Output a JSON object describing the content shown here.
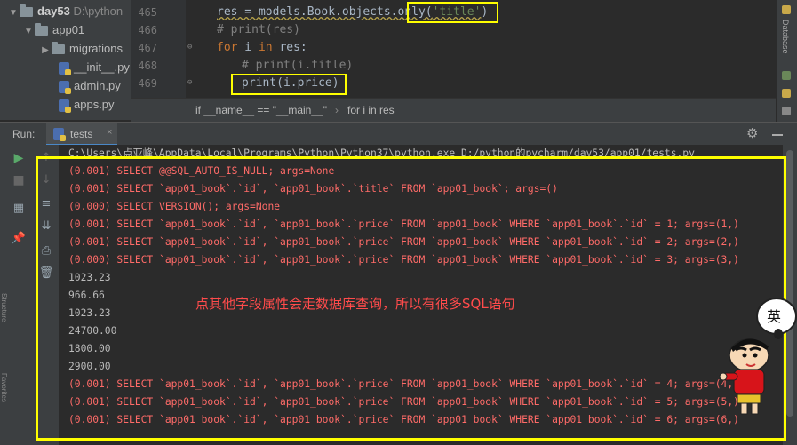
{
  "project": {
    "items": [
      {
        "label": "day53",
        "suffix": "D:\\python",
        "kind": "folder",
        "expanded": true,
        "icon": "folder-icon"
      },
      {
        "label": "app01",
        "kind": "folder",
        "expanded": true,
        "icon": "folder-icon"
      },
      {
        "label": "migrations",
        "kind": "folder",
        "expanded": false,
        "icon": "folder-icon"
      },
      {
        "label": "__init__.py",
        "kind": "file",
        "icon": "python-file-icon"
      },
      {
        "label": "admin.py",
        "kind": "file",
        "icon": "python-file-icon"
      },
      {
        "label": "apps.py",
        "kind": "file",
        "icon": "python-file-icon"
      }
    ]
  },
  "editor": {
    "line_numbers": [
      "465",
      "466",
      "467",
      "468",
      "469"
    ],
    "lines": [
      {
        "pre": "res = models.Book.objects.only(",
        "str": "'title'",
        "post": ")"
      },
      {
        "comment": "# print(res)"
      },
      {
        "kw": "for",
        "text1": " i ",
        "kw2": "in",
        "text2": " res:"
      },
      {
        "comment": "# print(i.title)"
      },
      {
        "text": "print(i.price)"
      }
    ]
  },
  "breadcrumb": {
    "items": [
      "if __name__ == \"__main__\"",
      "for i in res"
    ]
  },
  "run": {
    "label": "Run:",
    "tab": "tests",
    "close_glyph": "×"
  },
  "console": {
    "lines": [
      {
        "text": "C:\\Users\\点亚峰\\AppData\\Local\\Programs\\Python\\Python37\\python.exe D:/python的pycharm/day53/app01/tests.py",
        "style": "plain"
      },
      {
        "text": "(0.001) SELECT @@SQL_AUTO_IS_NULL; args=None",
        "style": "red"
      },
      {
        "text": "(0.001) SELECT `app01_book`.`id`, `app01_book`.`title` FROM `app01_book`; args=()",
        "style": "red"
      },
      {
        "text": "(0.000) SELECT VERSION(); args=None",
        "style": "red"
      },
      {
        "text": "(0.001) SELECT `app01_book`.`id`, `app01_book`.`price` FROM `app01_book` WHERE `app01_book`.`id` = 1; args=(1,)",
        "style": "red"
      },
      {
        "text": "(0.001) SELECT `app01_book`.`id`, `app01_book`.`price` FROM `app01_book` WHERE `app01_book`.`id` = 2; args=(2,)",
        "style": "red"
      },
      {
        "text": "(0.000) SELECT `app01_book`.`id`, `app01_book`.`price` FROM `app01_book` WHERE `app01_book`.`id` = 3; args=(3,)",
        "style": "red"
      },
      {
        "text": "1023.23",
        "style": "plain"
      },
      {
        "text": "966.66",
        "style": "plain"
      },
      {
        "text": "1023.23",
        "style": "plain"
      },
      {
        "text": "24700.00",
        "style": "plain"
      },
      {
        "text": "1800.00",
        "style": "plain"
      },
      {
        "text": "2900.00",
        "style": "plain"
      },
      {
        "text": "(0.001) SELECT `app01_book`.`id`, `app01_book`.`price` FROM `app01_book` WHERE `app01_book`.`id` = 4; args=(4,)",
        "style": "red"
      },
      {
        "text": "(0.001) SELECT `app01_book`.`id`, `app01_book`.`price` FROM `app01_book` WHERE `app01_book`.`id` = 5; args=(5,)",
        "style": "red"
      },
      {
        "text": "(0.001) SELECT `app01_book`.`id`, `app01_book`.`price` FROM `app01_book` WHERE `app01_book`.`id` = 6; args=(6,)",
        "style": "red"
      }
    ],
    "annotation": "点其他字段属性会走数据库查询，所以有很多SQL语句"
  },
  "sticker": {
    "bubble_text": "英"
  },
  "colors": {
    "highlight": "#ffff00",
    "sql_red": "#ff6b68",
    "annotation_red": "#ff4b4b",
    "background": "#2b2b2b",
    "panel": "#3c3f41"
  },
  "icons": {
    "run": "run-icon",
    "stop": "stop-icon",
    "settings": "gear-icon"
  }
}
